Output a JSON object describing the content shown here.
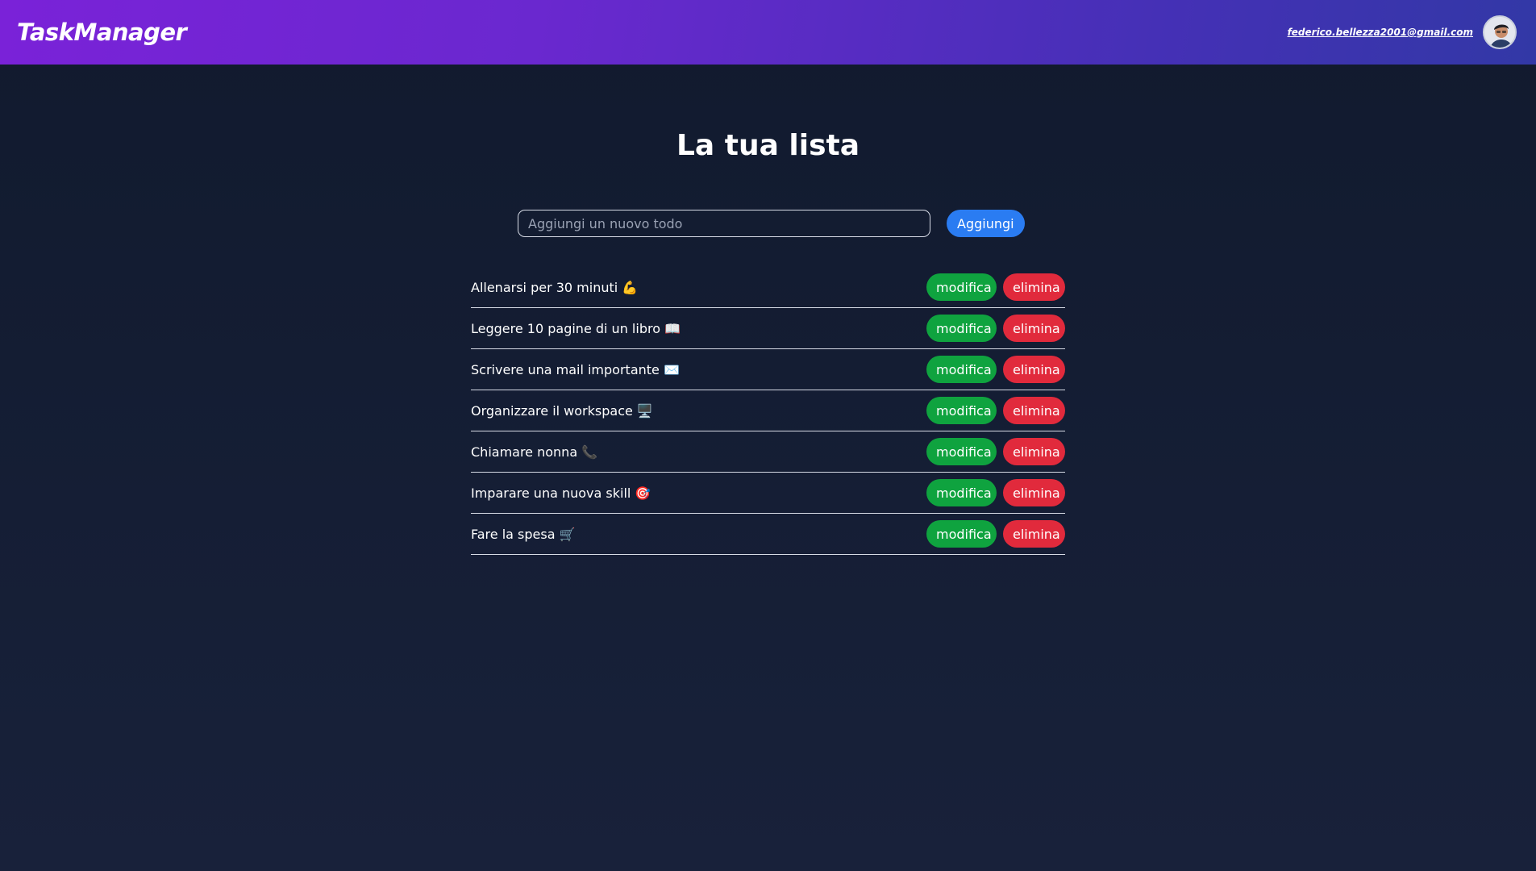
{
  "header": {
    "brand": "TaskManager",
    "user_email": "federico.bellezza2001@gmail.com",
    "avatar_icon": "user-avatar-icon"
  },
  "main": {
    "title": "La tua lista",
    "add": {
      "placeholder": "Aggiungi un nuovo todo",
      "value": "",
      "button_label": "Aggiungi"
    },
    "todos": [
      {
        "text": "Allenarsi per 30 minuti 💪",
        "edit_label": "modifica",
        "delete_label": "elimina"
      },
      {
        "text": "Leggere 10 pagine di un libro 📖",
        "edit_label": "modifica",
        "delete_label": "elimina"
      },
      {
        "text": "Scrivere una mail importante ✉️",
        "edit_label": "modifica",
        "delete_label": "elimina"
      },
      {
        "text": "Organizzare il workspace 🖥️",
        "edit_label": "modifica",
        "delete_label": "elimina"
      },
      {
        "text": "Chiamare nonna 📞",
        "edit_label": "modifica",
        "delete_label": "elimina"
      },
      {
        "text": "Imparare una nuova skill 🎯",
        "edit_label": "modifica",
        "delete_label": "elimina"
      },
      {
        "text": "Fare la spesa 🛒",
        "edit_label": "modifica",
        "delete_label": "elimina"
      }
    ]
  },
  "colors": {
    "header_start": "#7a22d8",
    "header_end": "#3238a6",
    "background": "#111a2e",
    "primary": "#2a7cf2",
    "edit": "#0fa33f",
    "delete": "#e12a3c"
  }
}
